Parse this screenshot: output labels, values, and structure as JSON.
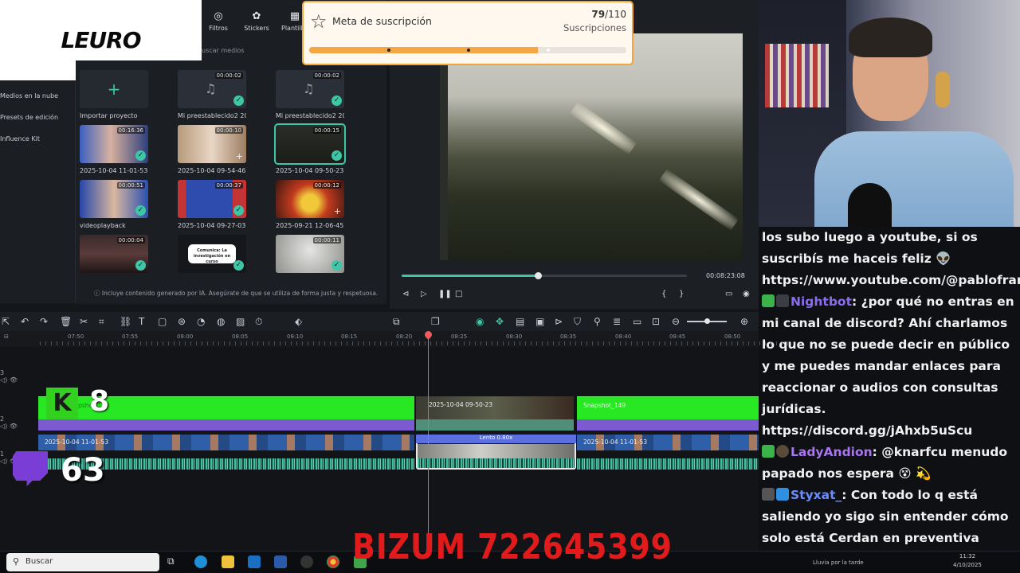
{
  "logo": {
    "text": "LEURO"
  },
  "editor": {
    "toolbar": [
      {
        "icon": "filter-icon",
        "label": "Filtros"
      },
      {
        "icon": "sticker-icon",
        "label": "Stickers"
      },
      {
        "icon": "template-icon",
        "label": "Plantillas"
      }
    ],
    "search_placeholder": "uscar medios",
    "sidebar": [
      "Medios en la nube",
      "Presets de edición",
      "Influence Kit"
    ],
    "media": [
      {
        "caption": "Importar proyecto",
        "duration": "",
        "kind": "import"
      },
      {
        "caption": "Mi preestablecido2 20...",
        "duration": "00:00:02",
        "kind": "audio",
        "checked": true
      },
      {
        "caption": "Mi preestablecido2 20...",
        "duration": "00:00:02",
        "kind": "audio",
        "checked": true
      },
      {
        "caption": "2025-10-04 11-01-53",
        "duration": "00:16:36",
        "kind": "video",
        "checked": true
      },
      {
        "caption": "2025-10-04 09-54-46",
        "duration": "00:00:10",
        "kind": "video",
        "checked": false
      },
      {
        "caption": "2025-10-04 09-50-23",
        "duration": "00:00:15",
        "kind": "video",
        "checked": true,
        "selected": true
      },
      {
        "caption": "videoplayback",
        "duration": "00:00:51",
        "kind": "video",
        "checked": true
      },
      {
        "caption": "2025-10-04 09-27-03",
        "duration": "00:00:37",
        "kind": "video",
        "checked": true
      },
      {
        "caption": "2025-09-21 12-06-45",
        "duration": "00:00:12",
        "kind": "video",
        "checked": false
      },
      {
        "caption": "",
        "duration": "00:00:04",
        "kind": "video",
        "checked": true
      },
      {
        "caption": "",
        "duration": "",
        "kind": "text",
        "checked": true,
        "overlay_text": "Comunica: La investigación en curso"
      },
      {
        "caption": "",
        "duration": "00:00:11",
        "kind": "video",
        "checked": true
      }
    ],
    "disclaimer": "Incluye contenido generado por IA. Asegúrate de que se utiliza de forma justa y respetuosa.",
    "player_time": "00:08:23:08",
    "timeline_ticks": [
      "07:50",
      "07:55",
      "08:00",
      "08:05",
      "08:10",
      "08:15",
      "08:20",
      "08:25",
      "08:30",
      "08:35",
      "08:40",
      "08:45",
      "08:50"
    ],
    "clips": {
      "green_a": "Snapshot_148",
      "green_mid": "2025-10-04 09-50-23",
      "green_b": "Snapshot_149",
      "main_a": "2025-10-04 11-01-53",
      "main_b": "2025-10-04 11-01-53",
      "slow": "Lento 0.80x"
    }
  },
  "goal": {
    "title": "Meta de suscripción",
    "current": "79",
    "target": "/110",
    "unit": "Suscripciones",
    "progress": 0.72
  },
  "overlays": {
    "kick_count": "8",
    "twitch_count": "63",
    "bizum": "BIZUM 722645399"
  },
  "chat": [
    {
      "user": "",
      "user_color": "#ffffff",
      "text": "los subo luego a youtube, si os suscribís me haceis feliz 👽 https://www.youtube.com/@pablofrancoabogado"
    },
    {
      "user": "Nightbot",
      "user_color": "#8b6cf0",
      "text": ": ¿por qué no entras en mi canal de discord? Ahí charlamos lo que no se puede decir en público y me puedes mandar enlaces para reaccionar o audios con consultas jurídicas. https://discord.gg/jAhxb5uScu"
    },
    {
      "user": "LadyAndion",
      "user_color": "#a975f0",
      "text": ": @knarfcu menudo papado nos espera 😵 💫"
    },
    {
      "user": "Styxat_",
      "user_color": "#6b8cff",
      "text": ": Con todo lo q está saliendo yo sigo sin entender cómo solo está Cerdan en preventiva"
    }
  ],
  "taskbar": {
    "search_placeholder": "Buscar",
    "weather": "Lluvia por la tarde",
    "time": "11:32",
    "date": "4/10/2025"
  },
  "colors": {
    "accent": "#3ec7a6",
    "goal_bar": "#f4a742",
    "kick_green": "#27e823",
    "twitch": "#7a3ed6",
    "bizum_red": "#e11b1b"
  }
}
